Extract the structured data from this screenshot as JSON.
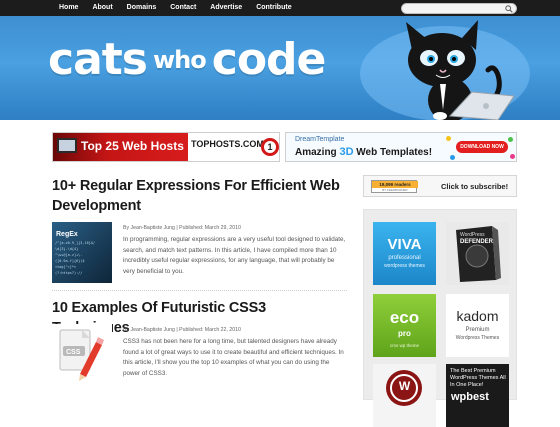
{
  "nav": {
    "items": [
      "Home",
      "About",
      "Domains",
      "Contact",
      "Advertise",
      "Contribute"
    ],
    "search_value": ""
  },
  "header": {
    "logo_part1": "cats",
    "logo_part2": "who",
    "logo_part3": "code"
  },
  "ads": {
    "ad1": {
      "headline": "Top 25 Web Hosts",
      "brand": "TOPHOSTS.COM",
      "badge": "1"
    },
    "ad2": {
      "brand": "DreamTemplate",
      "headline_a": "Amazing",
      "headline_3d": "3D",
      "headline_b": "Web Templates!",
      "button": "DOWNLOAD NOW"
    }
  },
  "posts": [
    {
      "title": "10+ Regular Expressions For Efficient Web Development",
      "meta": "By Jean-Baptiste Jung | Published: March 29, 2010",
      "excerpt": "In programming, regular expressions are a very useful tool designed to validate, search, and match text patterns. In this article, I have compiled more than 10 incredibly useful regular expressions, for any language, that will probably be very beneficial to you.",
      "thumb_label": "RegEx"
    },
    {
      "title": "10 Examples Of Futuristic CSS3 Techniques",
      "meta": "By Jean-Baptiste Jung | Published: March 22, 2010",
      "excerpt": "CSS3 has not been here for a long time, but talented designers have already found a lot of great ways to use it to create beautiful and efficient techniques. In this article, I'll show you the top 10 examples of what you can do using the power of CSS3.",
      "thumb_label": "CSS"
    }
  ],
  "sidebar": {
    "rss_count": "19,099 readers",
    "rss_feed": "BY FEEDBURNER",
    "rss_cta": "Click to subscribe!",
    "tiles": [
      {
        "title": "VIVA",
        "subtitle": "professional",
        "sub2": "wordpress themes",
        "color": "#27a2e2"
      },
      {
        "title": "WordPress",
        "subtitle": "DEFENDER",
        "color": "#2b2b2b"
      },
      {
        "title": "eco",
        "subtitle": "pro",
        "sub2": "cms wp theme",
        "color": "#76b82a"
      },
      {
        "title": "kadom",
        "subtitle": "Premium",
        "sub2": "Wordpress Themes",
        "color": "#ffffff"
      },
      {
        "title": "W",
        "color": "#f4f4f4"
      },
      {
        "title": "The Best Premium WordPress Themes All In One Place!",
        "subtitle": "wpbest",
        "color": "#1a1a1a"
      }
    ]
  }
}
